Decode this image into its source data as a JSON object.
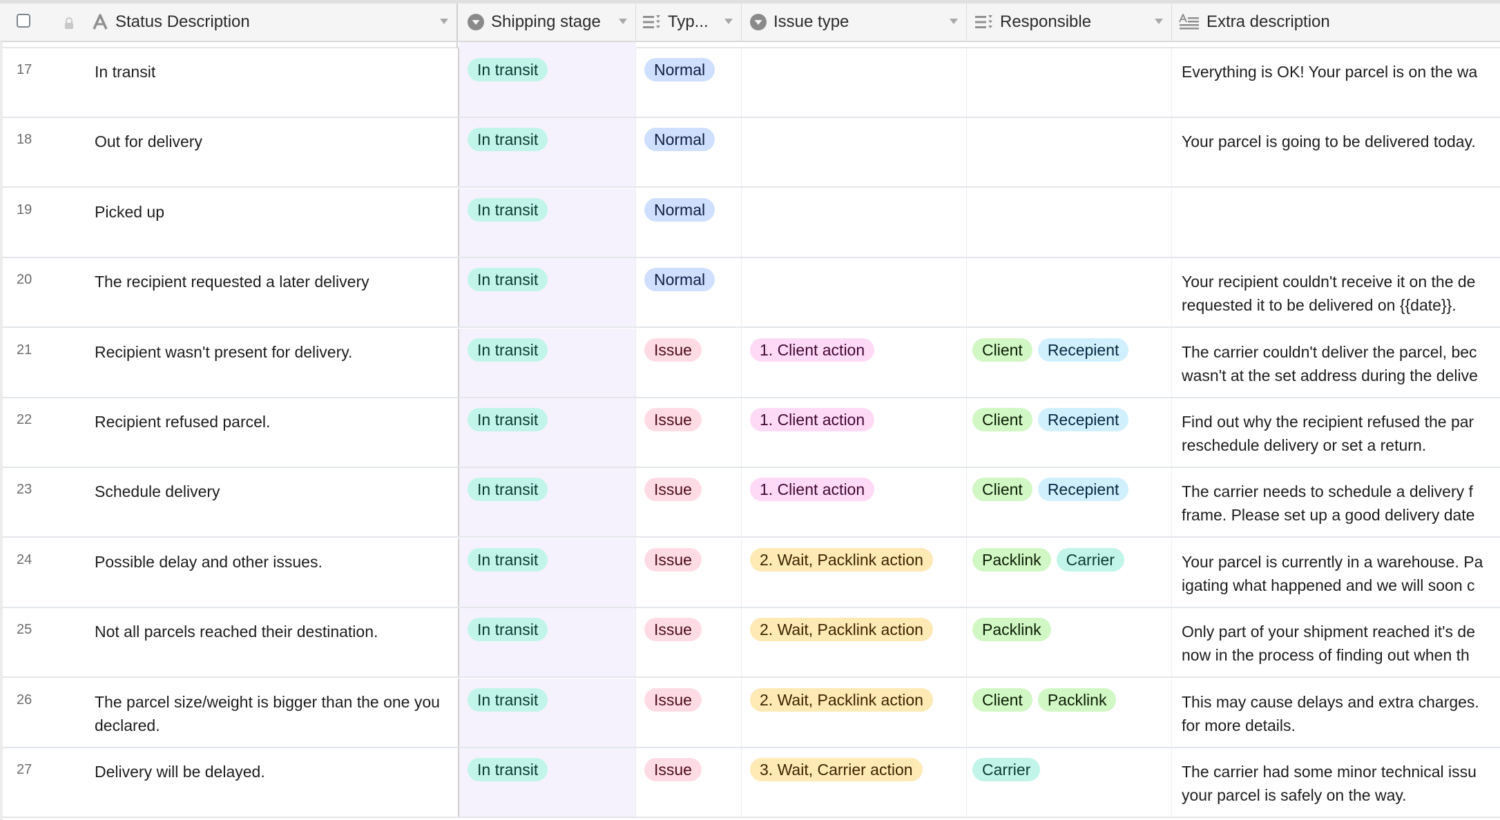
{
  "header": {
    "columns": [
      {
        "key": "status_description",
        "label": "Status Description",
        "icon": "text-field-icon"
      },
      {
        "key": "shipping_stage",
        "label": "Shipping stage",
        "icon": "single-select-icon"
      },
      {
        "key": "type",
        "label": "Typ...",
        "icon": "multi-select-icon"
      },
      {
        "key": "issue_type",
        "label": "Issue type",
        "icon": "single-select-icon"
      },
      {
        "key": "responsible",
        "label": "Responsible",
        "icon": "multi-select-icon"
      },
      {
        "key": "extra_description",
        "label": "Extra description",
        "icon": "long-text-icon"
      }
    ]
  },
  "colors": {
    "in_transit": "#c2f5e9",
    "normal": "#cfdfff",
    "issue": "#ffdce5",
    "client_action": "#ffdaf6",
    "wait_action": "#ffeab6",
    "client": "#d1f7c4",
    "recipient": "#d0f0fd",
    "packlink": "#d1f7c4",
    "carrier": "#c2f5e9",
    "stage_column_bg": "#f5f2fd"
  },
  "rows": [
    {
      "num": "17",
      "desc": "In transit",
      "stage": "In transit",
      "type": "Normal",
      "issue": "",
      "responsible": [],
      "extra": "Everything is OK! Your parcel is on the wa"
    },
    {
      "num": "18",
      "desc": "Out for delivery",
      "stage": "In transit",
      "type": "Normal",
      "issue": "",
      "responsible": [],
      "extra": "Your parcel is going to be delivered today."
    },
    {
      "num": "19",
      "desc": "Picked up",
      "stage": "In transit",
      "type": "Normal",
      "issue": "",
      "responsible": [],
      "extra": ""
    },
    {
      "num": "20",
      "desc": "The recipient requested a later delivery",
      "stage": "In transit",
      "type": "Normal",
      "issue": "",
      "responsible": [],
      "extra": "Your recipient couldn't receive it on the de\nrequested it to be delivered on {{date}}."
    },
    {
      "num": "21",
      "desc": "Recipient wasn't present for delivery.",
      "stage": "In transit",
      "type": "Issue",
      "issue": "1. Client action",
      "responsible": [
        "Client",
        "Recepient"
      ],
      "extra": "The carrier couldn't deliver the parcel, bec\nwasn't at the set address during the delive"
    },
    {
      "num": "22",
      "desc": "Recipient refused parcel.",
      "stage": "In transit",
      "type": "Issue",
      "issue": "1. Client action",
      "responsible": [
        "Client",
        "Recepient"
      ],
      "extra": "Find out why the recipient refused the par\nreschedule delivery or set a return."
    },
    {
      "num": "23",
      "desc": "Schedule delivery",
      "stage": "In transit",
      "type": "Issue",
      "issue": "1. Client action",
      "responsible": [
        "Client",
        "Recepient"
      ],
      "extra": "The carrier needs to schedule a delivery f\nframe. Please set up a good delivery date"
    },
    {
      "num": "24",
      "desc": "Possible delay and other issues.",
      "stage": "In transit",
      "type": "Issue",
      "issue": "2. Wait, Packlink action",
      "responsible": [
        "Packlink",
        "Carrier"
      ],
      "extra": "Your parcel is currently in a warehouse. Pa\nigating what happened and we will soon c"
    },
    {
      "num": "25",
      "desc": "Not all parcels reached their destination.",
      "stage": "In transit",
      "type": "Issue",
      "issue": "2. Wait, Packlink action",
      "responsible": [
        "Packlink"
      ],
      "extra": "Only part of your shipment reached it's de\nnow in the process of finding out when th"
    },
    {
      "num": "26",
      "desc": "The parcel size/weight is bigger than the one you declared.",
      "stage": "In transit",
      "type": "Issue",
      "issue": "2. Wait, Packlink action",
      "responsible": [
        "Client",
        "Packlink"
      ],
      "extra": "This may cause delays and extra charges.\nfor more details."
    },
    {
      "num": "27",
      "desc": "Delivery will be delayed.",
      "stage": "In transit",
      "type": "Issue",
      "issue": "3. Wait, Carrier action",
      "responsible": [
        "Carrier"
      ],
      "extra": "The carrier had some minor technical issu\nyour parcel is safely on the way."
    }
  ]
}
